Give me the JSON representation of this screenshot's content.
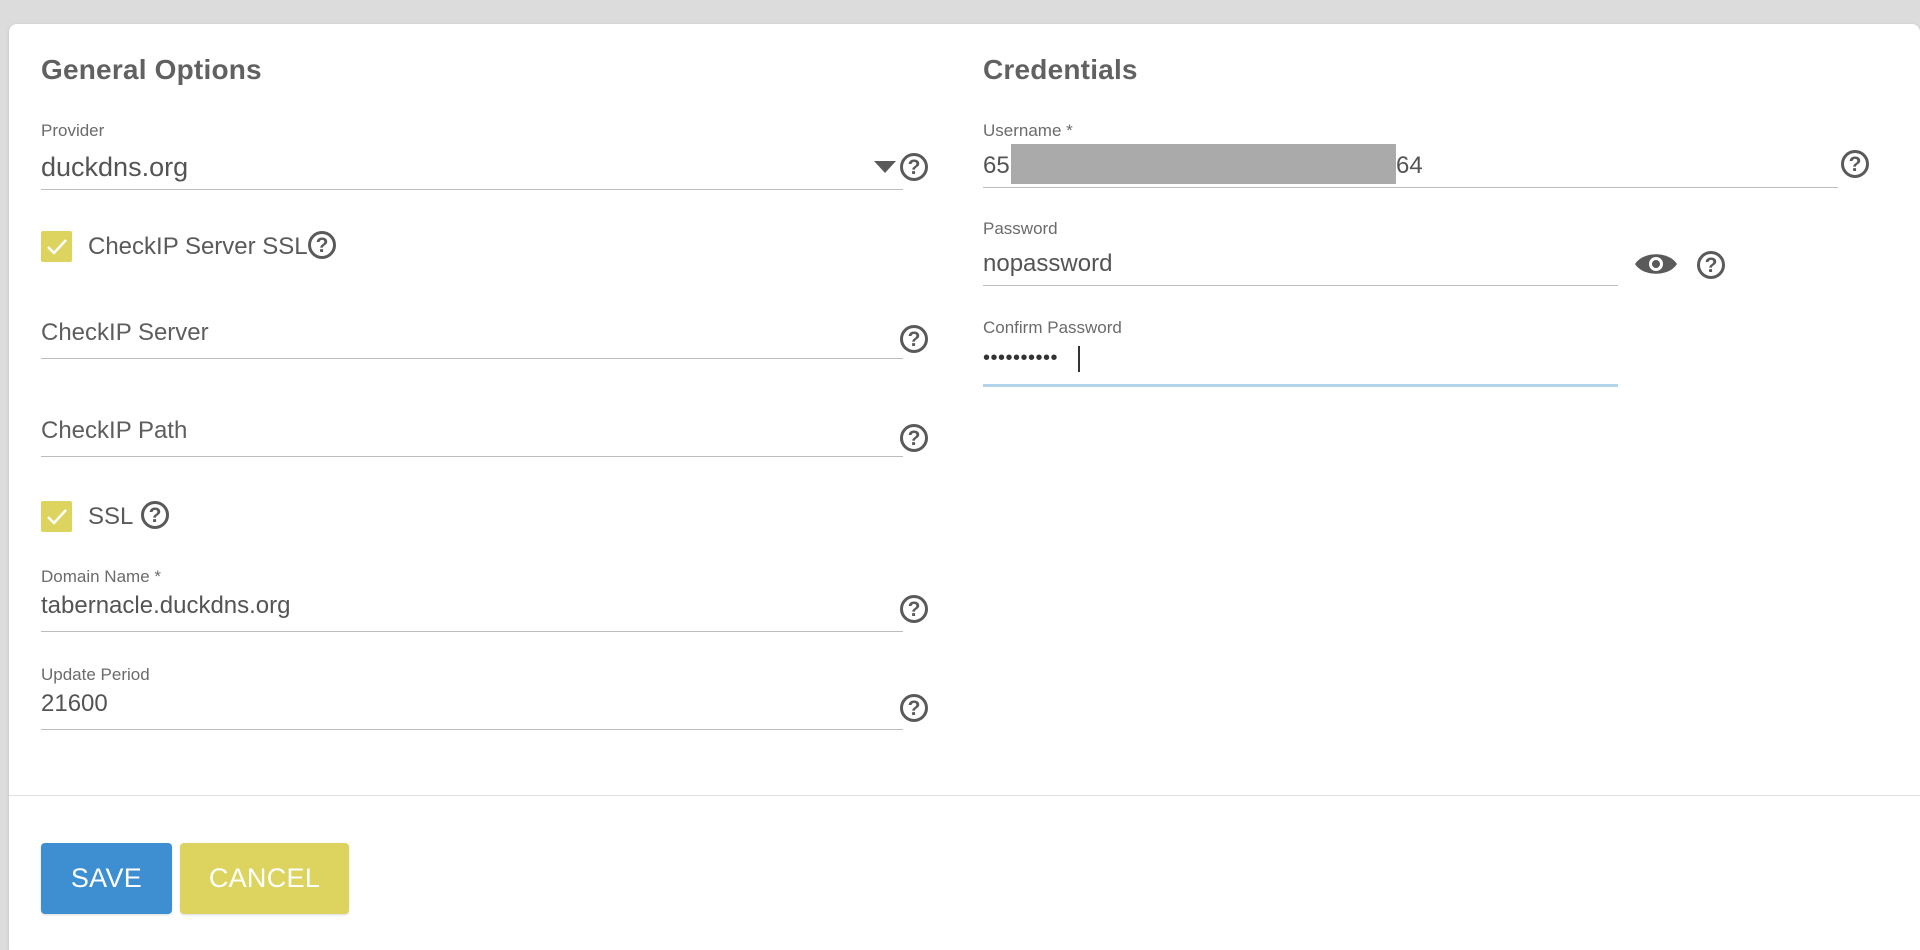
{
  "general": {
    "title": "General Options",
    "provider": {
      "label": "Provider",
      "value": "duckdns.org"
    },
    "checkip_server_ssl": {
      "label": "CheckIP Server SSL",
      "checked": true
    },
    "checkip_server": {
      "placeholder": "CheckIP Server",
      "value": ""
    },
    "checkip_path": {
      "placeholder": "CheckIP Path",
      "value": ""
    },
    "ssl": {
      "label": "SSL",
      "checked": true
    },
    "domain_name": {
      "label": "Domain Name *",
      "value": "tabernacle.duckdns.org"
    },
    "update_period": {
      "label": "Update Period",
      "value": "21600"
    }
  },
  "credentials": {
    "title": "Credentials",
    "username": {
      "label": "Username *",
      "value_prefix": "65",
      "value_suffix": "64"
    },
    "password": {
      "label": "Password",
      "value": "nopassword"
    },
    "confirm_password": {
      "label": "Confirm Password",
      "value": "••••••••••"
    }
  },
  "actions": {
    "save_label": "SAVE",
    "cancel_label": "CANCEL"
  },
  "icons": {
    "help": "help-circle-icon",
    "dropdown": "triangle-down-icon",
    "check": "checkmark-icon",
    "visibility": "eye-icon"
  },
  "colors": {
    "accent_blue": "#3d8fd1",
    "accent_yellow": "#ddd45f",
    "focus_underline": "#b3d4ea"
  },
  "help_glyph": "?"
}
